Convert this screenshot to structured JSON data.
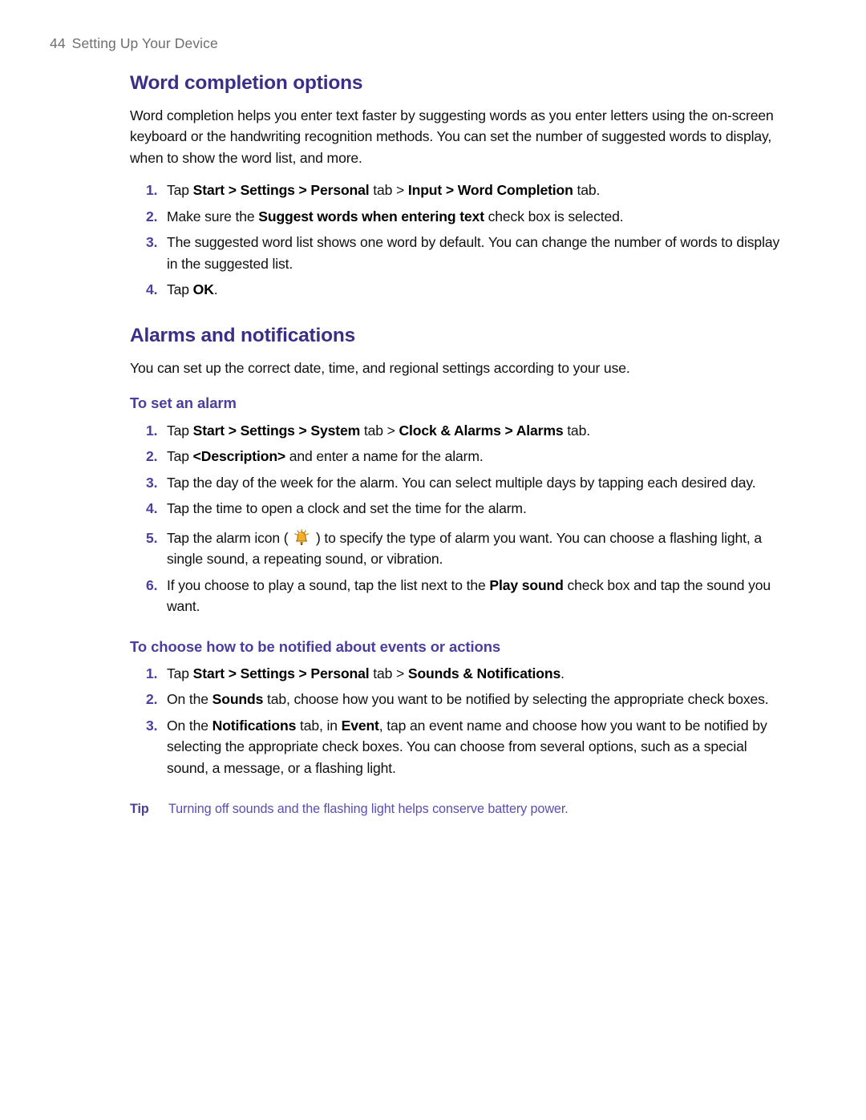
{
  "header": {
    "folio": "44",
    "title": "Setting Up Your Device"
  },
  "colors": {
    "heading": "#3a2f86",
    "subheading": "#4b3f9e",
    "list_number": "#4b3f9e",
    "tip": "#5b4fae",
    "body": "#101010",
    "running_header": "#6e6e6e",
    "icon_bell": "#f0a81e"
  },
  "sections": [
    {
      "title": "Word completion options",
      "intro": "Word completion helps you enter text faster by suggesting words as you enter letters using the on-screen keyboard or the handwriting recognition methods. You can set the number of suggested words to display, when to show the word list, and more.",
      "steps": [
        {
          "num": "1.",
          "parts": [
            {
              "t": "Tap ",
              "b": false
            },
            {
              "t": "Start > Settings > Personal",
              "b": true
            },
            {
              "t": " tab > ",
              "b": false
            },
            {
              "t": "Input > Word Completion",
              "b": true
            },
            {
              "t": " tab.",
              "b": false
            }
          ]
        },
        {
          "num": "2.",
          "parts": [
            {
              "t": "Make sure the ",
              "b": false
            },
            {
              "t": "Suggest words when entering text",
              "b": true
            },
            {
              "t": " check box is selected.",
              "b": false
            }
          ]
        },
        {
          "num": "3.",
          "parts": [
            {
              "t": "The suggested word list shows one word by default. You can change the number of words to display in the suggested list.",
              "b": false
            }
          ]
        },
        {
          "num": "4.",
          "parts": [
            {
              "t": "Tap ",
              "b": false
            },
            {
              "t": "OK",
              "b": true
            },
            {
              "t": ".",
              "b": false
            }
          ]
        }
      ]
    },
    {
      "title": "Alarms and notifications",
      "intro": "You can set up the correct date, time, and regional settings according to your use.",
      "subsections": [
        {
          "title": "To set an alarm",
          "steps": [
            {
              "num": "1.",
              "parts": [
                {
                  "t": "Tap ",
                  "b": false
                },
                {
                  "t": "Start > Settings > System",
                  "b": true
                },
                {
                  "t": " tab > ",
                  "b": false
                },
                {
                  "t": "Clock & Alarms > Alarms",
                  "b": true
                },
                {
                  "t": " tab.",
                  "b": false
                }
              ]
            },
            {
              "num": "2.",
              "parts": [
                {
                  "t": "Tap ",
                  "b": false
                },
                {
                  "t": "<Description>",
                  "b": true
                },
                {
                  "t": " and enter a name for the alarm.",
                  "b": false
                }
              ]
            },
            {
              "num": "3.",
              "parts": [
                {
                  "t": "Tap the day of the week for the alarm. You can select multiple days by tapping each desired day.",
                  "b": false
                }
              ]
            },
            {
              "num": "4.",
              "parts": [
                {
                  "t": "Tap the time to open a clock and set the time for the alarm.",
                  "b": false
                }
              ]
            },
            {
              "num": "5.",
              "icon": "alarm-bell-icon",
              "parts": [
                {
                  "t": "Tap the alarm icon ( ",
                  "b": false
                },
                {
                  "icon": "alarm-bell-icon"
                },
                {
                  "t": " ) to specify the type of alarm you want. You can choose a flashing light, a single sound, a repeating sound, or vibration.",
                  "b": false
                }
              ]
            },
            {
              "num": "6.",
              "parts": [
                {
                  "t": "If you choose to play a sound, tap the list next to the ",
                  "b": false
                },
                {
                  "t": "Play sound",
                  "b": true
                },
                {
                  "t": " check box and tap the sound you want.",
                  "b": false
                }
              ]
            }
          ]
        },
        {
          "title": "To choose how to be notified about events or actions",
          "steps": [
            {
              "num": "1.",
              "parts": [
                {
                  "t": "Tap ",
                  "b": false
                },
                {
                  "t": "Start > Settings > Personal",
                  "b": true
                },
                {
                  "t": " tab > ",
                  "b": false
                },
                {
                  "t": "Sounds & Notifications",
                  "b": true
                },
                {
                  "t": ".",
                  "b": false
                }
              ]
            },
            {
              "num": "2.",
              "parts": [
                {
                  "t": "On the ",
                  "b": false
                },
                {
                  "t": "Sounds",
                  "b": true
                },
                {
                  "t": " tab, choose how you want to be notified by selecting the appropriate check boxes.",
                  "b": false
                }
              ]
            },
            {
              "num": "3.",
              "parts": [
                {
                  "t": "On the ",
                  "b": false
                },
                {
                  "t": "Notifications",
                  "b": true
                },
                {
                  "t": " tab, in ",
                  "b": false
                },
                {
                  "t": "Event",
                  "b": true
                },
                {
                  "t": ", tap an event name and choose how you want to be notified by selecting the appropriate check boxes. You can choose from several options, such as a special sound, a message, or a flashing light.",
                  "b": false
                }
              ]
            }
          ]
        }
      ]
    }
  ],
  "tip": {
    "label": "Tip",
    "text": "Turning off sounds and the flashing light helps conserve battery power."
  }
}
